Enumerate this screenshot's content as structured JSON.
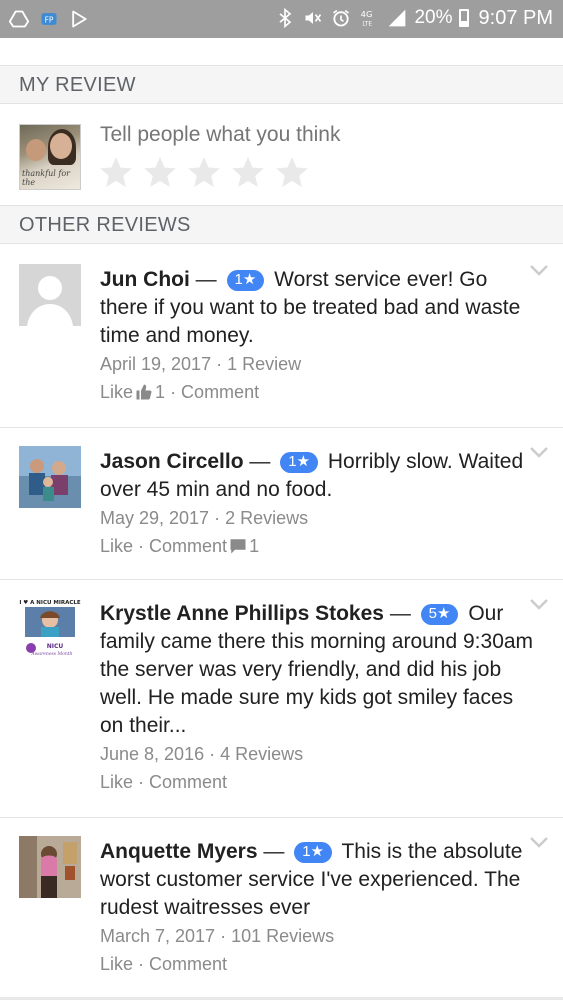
{
  "status_bar": {
    "battery_text": "20%",
    "time": "9:07 PM",
    "network_label": "4G LTE",
    "icons": [
      "drive-icon",
      "app-icon",
      "play-icon",
      "bluetooth-icon",
      "mute-icon",
      "alarm-icon",
      "lte-icon",
      "signal-icon",
      "battery-icon"
    ]
  },
  "my_review": {
    "header": "MY REVIEW",
    "prompt": "Tell people what you think",
    "avatar_caption": "thankful for the",
    "stars_count": 5
  },
  "other_reviews": {
    "header": "OTHER REVIEWS",
    "items": [
      {
        "name": "Jun Choi",
        "dash": "—",
        "rating": "1★",
        "text": "Worst service ever! Go there if you want to be treated bad and waste time and money.",
        "meta": "April 19, 2017 · 1 Review",
        "like_label": "Like",
        "like_count": "1",
        "comment_label": "· Comment",
        "comment_count": ""
      },
      {
        "name": "Jason Circello",
        "dash": "—",
        "rating": "1★",
        "text": "Horribly slow. Waited over 45 min and no food.",
        "meta": "May 29, 2017 · 2 Reviews",
        "like_label": "Like",
        "like_count": "",
        "comment_label": "· Comment",
        "comment_count": "1"
      },
      {
        "name": "Krystle Anne Phillips Stokes",
        "dash": "—",
        "rating": "5★",
        "text": "Our family came there this morning around 9:30am the server was very friendly, and did his job well. He made sure my kids got smiley faces on their...",
        "meta": "June 8, 2016 · 4 Reviews",
        "like_label": "Like",
        "like_count": "",
        "comment_label": "· Comment",
        "comment_count": "",
        "avatar_text_top": "I ♥ A NICU MIRACLE",
        "avatar_text_bottom": "NICU Awareness Month"
      },
      {
        "name": "Anquette Myers",
        "dash": "—",
        "rating": "1★",
        "text": "This is the absolute worst customer service I've experienced. The rudest waitresses ever",
        "meta": "March 7, 2017 · 101 Reviews",
        "like_label": "Like",
        "like_count": "",
        "comment_label": "· Comment",
        "comment_count": ""
      }
    ]
  },
  "colors": {
    "status_bar": "#9e9e9e",
    "badge": "#4285f4",
    "section_bg": "#f5f5f5",
    "meta_text": "#8a8a8a"
  }
}
